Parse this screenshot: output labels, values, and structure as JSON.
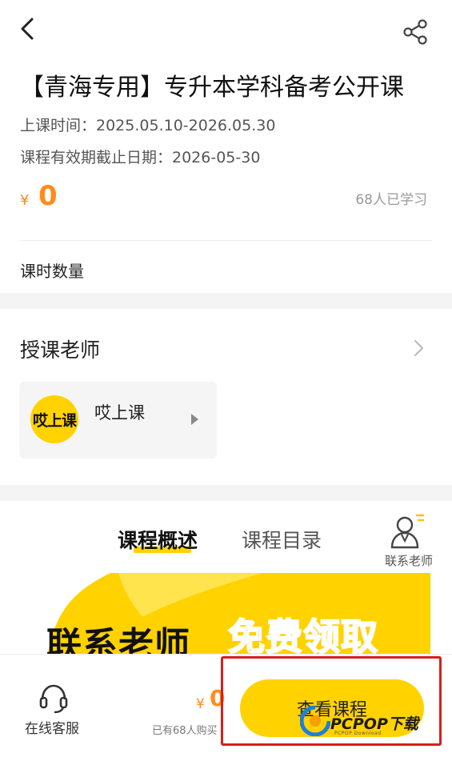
{
  "header": {
    "back_icon": "chevron-left-icon",
    "share_icon": "share-icon"
  },
  "course": {
    "title": "【青海专用】专升本学科备考公开课",
    "class_time": "上课时间：2025.05.10-2026.05.30",
    "valid_until": "课程有效期截止日期：2026-05-30",
    "price_symbol": "¥",
    "price": "0",
    "learned_count": "68人已学习",
    "lesson_count_label": "课时数量",
    "accent_color": "#ff8c1a"
  },
  "teacher_section": {
    "heading": "授课老师",
    "teacher": {
      "avatar_text": "哎上课",
      "name": "哎上课"
    }
  },
  "tabs": {
    "items": [
      "课程概述",
      "课程目录"
    ],
    "active_index": 0,
    "contact_label": "联系老师"
  },
  "banner": {
    "text_black": "联系老师",
    "text_red": "免费领取"
  },
  "bottom_bar": {
    "customer_service_label": "在线客服",
    "price_symbol": "¥",
    "price": "0",
    "bought_text": "已有68人购买",
    "view_course_label": "查看课程",
    "brand_color": "#ffd200"
  },
  "watermark": {
    "text": "PCPOP下载",
    "subtext": "PCPOP Download"
  }
}
